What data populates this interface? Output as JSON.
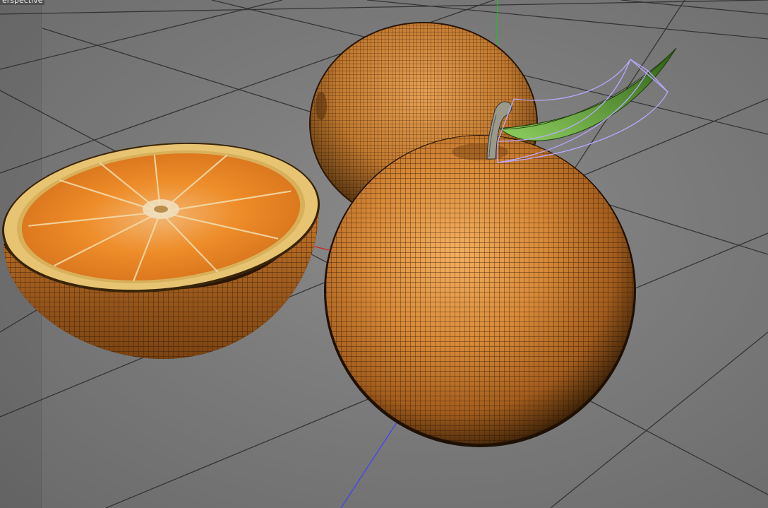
{
  "viewport": {
    "view_label": "erspective"
  },
  "scene": {
    "objects": [
      "half-orange",
      "back-orange",
      "front-orange",
      "stem",
      "leaf"
    ],
    "colors": {
      "background": "#7b7b7b",
      "grid_line": "#2a2a2a",
      "orange_peel": "#c8752a",
      "orange_flesh": "#e98a2a",
      "pith": "#e8c36a",
      "leaf": "#3f7a1e",
      "selection_box": "#b9a8ff",
      "axis_y": "#20c020",
      "axis_z": "#4040ff",
      "axis_x": "#d02020"
    }
  }
}
